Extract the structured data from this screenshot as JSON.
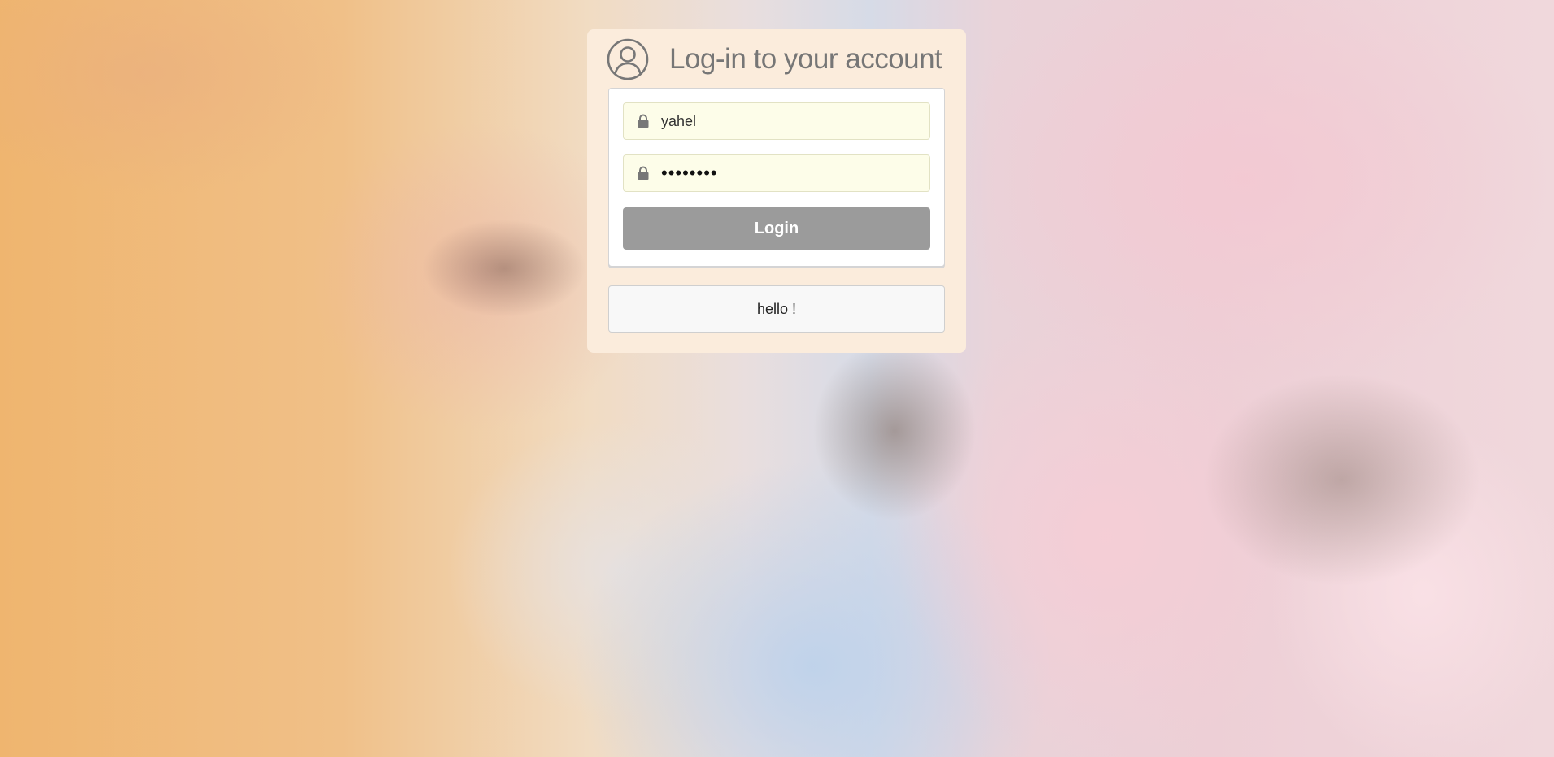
{
  "login": {
    "title": "Log-in to your account",
    "username_value": "yahel",
    "password_value": "••••••••",
    "login_label": "Login",
    "message": "hello !"
  },
  "icons": {
    "header": "user-circle-icon",
    "username_field": "lock-icon",
    "password_field": "lock-icon"
  },
  "colors": {
    "card_background": "#fbecdc",
    "field_background": "#fdfde9",
    "login_button": "#9b9b9b",
    "title_text": "#767676"
  }
}
